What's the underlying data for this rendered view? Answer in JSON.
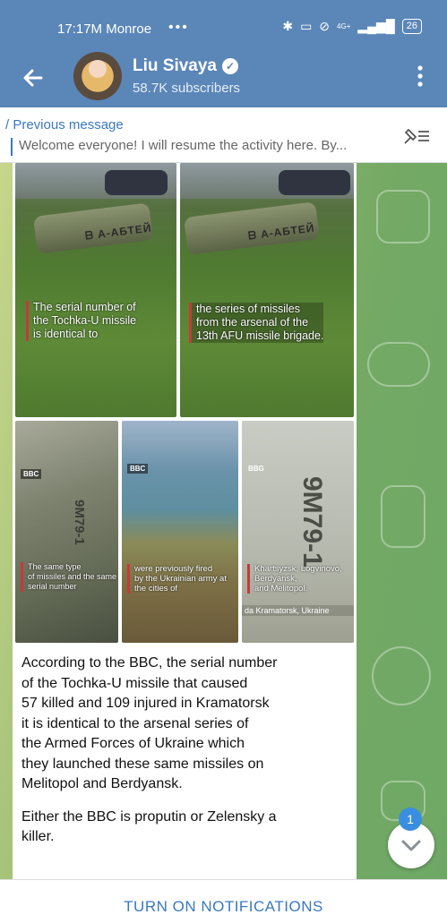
{
  "status_bar": {
    "time": "17:17",
    "carrier": "M Monroe",
    "more_dots": "•••",
    "network": "4G+",
    "battery": "26"
  },
  "header": {
    "channel_name": "Liu Sivaya",
    "subscribers": "58.7K subscribers"
  },
  "pinned": {
    "label": "/ Previous message",
    "text": "Welcome everyone! I will resume the activity here. By..."
  },
  "media": {
    "tile1": {
      "missile_text": "ᗷ A-AБТЕЙ",
      "caption": "The serial number of\nthe Tochka-U missile\nis identical to"
    },
    "tile2": {
      "missile_text": "ᗷ A-AБТЕЙ",
      "caption": "the series of missiles\nfrom the arsenal of the\n13th AFU missile brigade."
    },
    "tile3": {
      "brand": "BBC",
      "serial": "9M79-1",
      "caption": "The same type\nof missiles and the same\nserial number"
    },
    "tile4": {
      "brand": "BBC",
      "caption": "were previously fired\nby the Ukrainian army at\nthe cities of"
    },
    "tile5": {
      "brand": "BBG",
      "serial": "9M79-1",
      "caption": "Khartsyzsk, Logvinovo,\nBerdyansk,\nand Melitopol.",
      "location": "da Kramatorsk, Ukraine"
    }
  },
  "message": {
    "paragraph1": "According to the BBC, the serial number\nof the Tochka-U missile that caused\n57 killed and 109 injured in Kramatorsk\nit is identical to the arsenal series of\nthe Armed Forces of Ukraine which\nthey launched these same missiles on\nMelitopol and Berdyansk.",
    "paragraph2": "Either the BBC is proputin or Zelensky a\nkiller."
  },
  "unread_badge": "1",
  "bottom": {
    "notifications_label": "TURN ON NOTIFICATIONS"
  },
  "colors": {
    "header": "#5b86b8",
    "accent": "#3a78c2",
    "badge": "#3a8ee0"
  }
}
